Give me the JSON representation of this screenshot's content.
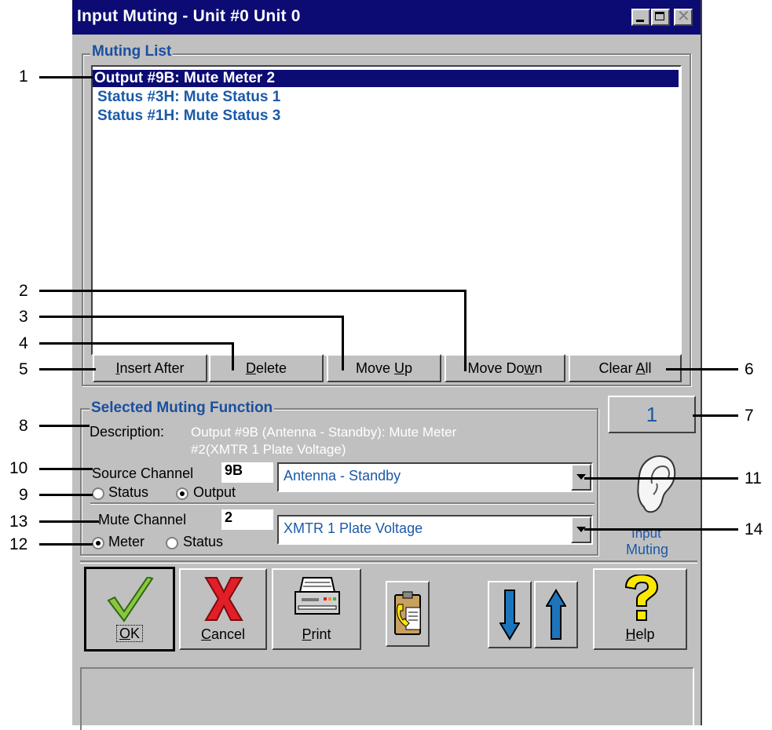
{
  "window": {
    "title": "Input Muting - Unit #0 Unit 0",
    "minimize_icon": "minimize-icon",
    "maximize_icon": "maximize-icon",
    "close_icon": "close-icon"
  },
  "muting_list": {
    "label": "Muting List",
    "items": [
      "Output #9B: Mute Meter 2",
      "Status #3H: Mute Status 1",
      "Status #1H: Mute Status 3"
    ],
    "selected_index": 0,
    "buttons": {
      "insert_after_pre": "",
      "insert_after_u": "I",
      "insert_after_post": "nsert After",
      "delete_pre": "",
      "delete_u": "D",
      "delete_post": "elete",
      "move_up_pre": "Move ",
      "move_up_u": "U",
      "move_up_post": "p",
      "move_down_pre": "Move Do",
      "move_down_u": "w",
      "move_down_post": "n",
      "clear_all_pre": "Clear ",
      "clear_all_u": "A",
      "clear_all_post": "ll"
    }
  },
  "selected_function": {
    "label": "Selected Muting Function",
    "description_label": "Description:",
    "description_line1": "Output #9B (Antenna - Standby): Mute Meter",
    "description_line2": "#2(XMTR 1 Plate Voltage)",
    "source_channel_label": "Source Channel",
    "source_channel_value": "9B",
    "source_combo_value": "Antenna - Standby",
    "source_radio_status": "Status",
    "source_radio_output": "Output",
    "source_selected": "Output",
    "mute_channel_label": "Mute Channel",
    "mute_channel_value": "2",
    "mute_combo_value": "XMTR 1 Plate Voltage",
    "mute_radio_meter": "Meter",
    "mute_radio_status": "Status",
    "mute_selected": "Meter"
  },
  "counter": "1",
  "side_icon": {
    "icon": "ear-icon",
    "label_line1": "Input",
    "label_line2": "Muting"
  },
  "toolbar": {
    "ok_u": "O",
    "ok_post": "K",
    "cancel_u": "C",
    "cancel_post": "ancel",
    "print_u": "P",
    "print_post": "rint",
    "help_u": "H",
    "help_post": "elp",
    "icons": [
      "checkmark-icon",
      "x-icon",
      "printer-icon",
      "clipboard-phone-icon",
      "arrow-down-icon",
      "arrow-up-icon",
      "question-icon"
    ]
  },
  "callouts": [
    "1",
    "2",
    "3",
    "4",
    "5",
    "6",
    "7",
    "8",
    "9",
    "10",
    "11",
    "12",
    "13",
    "14"
  ],
  "colors": {
    "title_bar": "#0b0b73",
    "window_face": "#c0c0c0",
    "list_text": "#1a5aa8",
    "group_label": "#1a4fa0",
    "ok_check": "#8cc63f",
    "cancel_x": "#e21e26",
    "arrow_blue": "#1c75bc",
    "help_yellow": "#ffe800"
  }
}
